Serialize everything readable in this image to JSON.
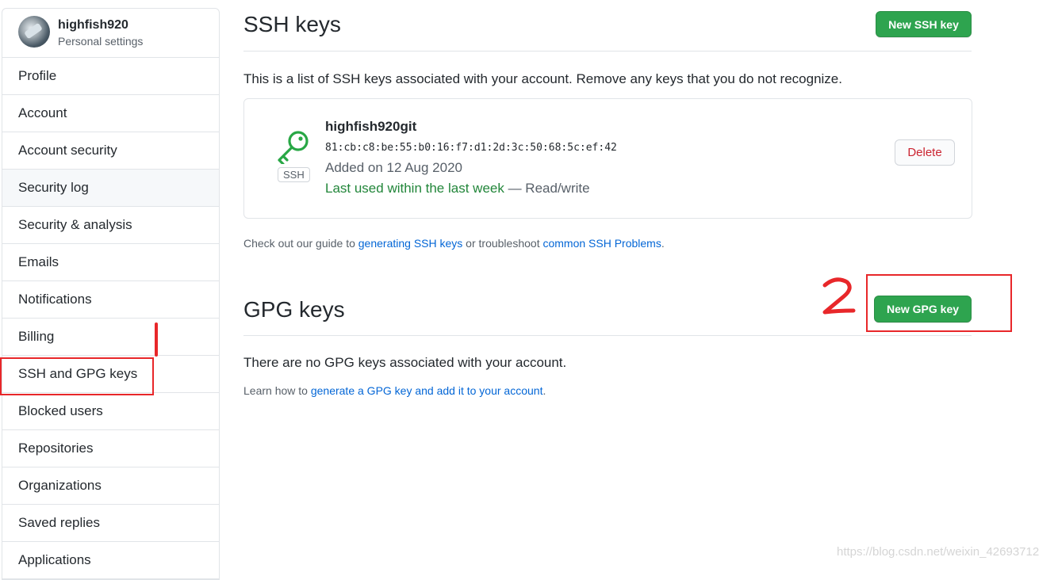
{
  "sidebar": {
    "username": "highfish920",
    "subtitle": "Personal settings",
    "items": [
      {
        "label": "Profile"
      },
      {
        "label": "Account"
      },
      {
        "label": "Account security"
      },
      {
        "label": "Security log"
      },
      {
        "label": "Security & analysis"
      },
      {
        "label": "Emails"
      },
      {
        "label": "Notifications"
      },
      {
        "label": "Billing"
      },
      {
        "label": "SSH and GPG keys"
      },
      {
        "label": "Blocked users"
      },
      {
        "label": "Repositories"
      },
      {
        "label": "Organizations"
      },
      {
        "label": "Saved replies"
      },
      {
        "label": "Applications"
      }
    ]
  },
  "ssh": {
    "title": "SSH keys",
    "new_button": "New SSH key",
    "intro": "This is a list of SSH keys associated with your account. Remove any keys that you do not recognize.",
    "key": {
      "badge": "SSH",
      "name": "highfish920git",
      "fingerprint": "81:cb:c8:be:55:b0:16:f7:d1:2d:3c:50:68:5c:ef:42",
      "added": "Added on 12 Aug 2020",
      "last_used": "Last used within the last week",
      "access": " — Read/write",
      "delete_label": "Delete"
    },
    "guide_prefix": "Check out our guide to ",
    "guide_link1": "generating SSH keys",
    "guide_mid": " or troubleshoot ",
    "guide_link2": "common SSH Problems",
    "guide_suffix": "."
  },
  "gpg": {
    "title": "GPG keys",
    "new_button": "New GPG key",
    "empty": "There are no GPG keys associated with your account.",
    "learn_prefix": "Learn how to ",
    "learn_link": "generate a GPG key and add it to your account",
    "learn_suffix": "."
  },
  "colors": {
    "accent_green": "#2ea44f",
    "link_blue": "#0366d6",
    "danger_red": "#cb2431",
    "annotation_red": "#e8272a"
  },
  "watermark": "https://blog.csdn.net/weixin_42693712"
}
